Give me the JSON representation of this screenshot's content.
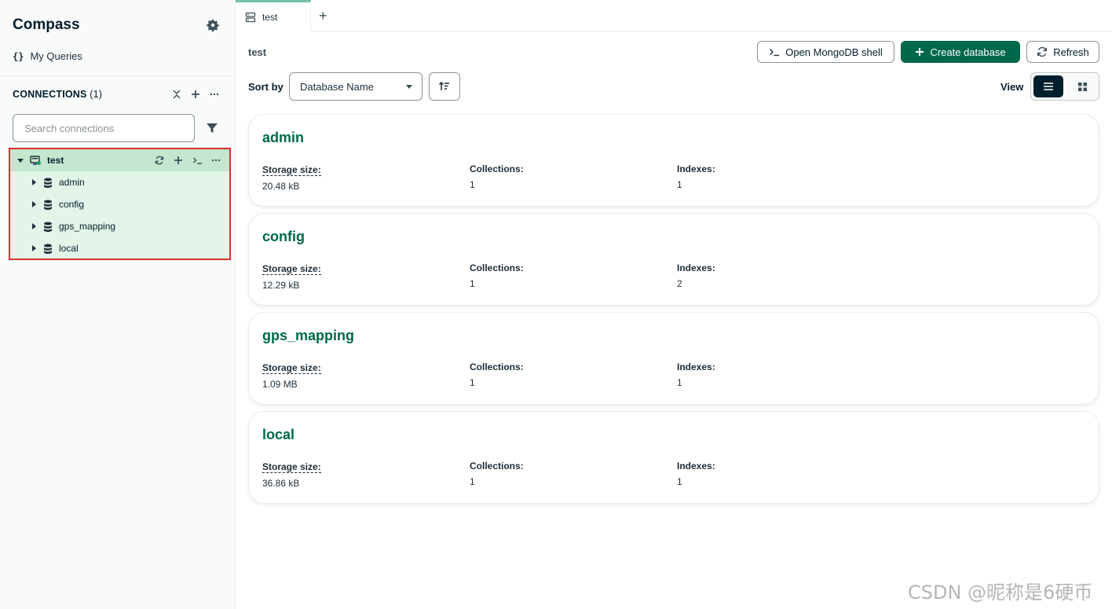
{
  "sidebar": {
    "app_title": "Compass",
    "my_queries": "My Queries",
    "connections_label": "CONNECTIONS",
    "connections_count": "(1)",
    "search_placeholder": "Search connections",
    "tree": {
      "connection": "test",
      "databases": [
        "admin",
        "config",
        "gps_mapping",
        "local"
      ]
    }
  },
  "tabs": [
    {
      "label": "test"
    }
  ],
  "toolbar": {
    "breadcrumb": "test",
    "open_shell": "Open MongoDB shell",
    "create_database": "Create database",
    "refresh": "Refresh",
    "sort_by_label": "Sort by",
    "sort_value": "Database Name",
    "view_label": "View"
  },
  "labels": {
    "storage": "Storage size:",
    "collections": "Collections:",
    "indexes": "Indexes:"
  },
  "databases": [
    {
      "name": "admin",
      "storage": "20.48 kB",
      "collections": "1",
      "indexes": "1"
    },
    {
      "name": "config",
      "storage": "12.29 kB",
      "collections": "1",
      "indexes": "2"
    },
    {
      "name": "gps_mapping",
      "storage": "1.09 MB",
      "collections": "1",
      "indexes": "1"
    },
    {
      "name": "local",
      "storage": "36.86 kB",
      "collections": "1",
      "indexes": "1"
    }
  ],
  "watermark": "CSDN @昵称是6硬币",
  "colors": {
    "brand_green": "#00684a",
    "dark": "#001e2b",
    "selection_bg": "#e3f4e8",
    "highlight_border": "#db3030",
    "tab_accent": "#71c3a1"
  }
}
